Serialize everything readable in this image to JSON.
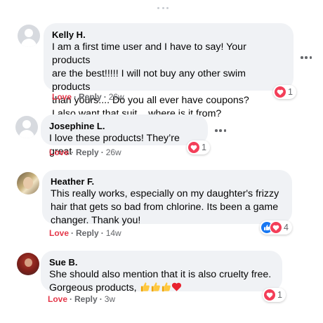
{
  "comments": [
    {
      "name": "Kelly H.",
      "text": "I am a first time user and I have to say! Your products\nare the best!!!!! I will not buy any other swim products\nthan yours.... Do you all ever have coupons?\nI also want that suit... where is it from?",
      "love_label": "Love",
      "reply_label": "Reply",
      "time": "26w",
      "reaction_count": "1",
      "reaction_icons": [
        "love-icon"
      ]
    },
    {
      "name": "Josephine L.",
      "text": "I love these products! They’re great",
      "love_label": "Love",
      "reply_label": "Reply",
      "time": "26w",
      "reaction_count": "1",
      "reaction_icons": [
        "love-icon"
      ]
    },
    {
      "name": "Heather F.",
      "text": "This really works, especially on my daughter's frizzy\nhair that gets so bad from chlorine. Its been a game\nchanger. Thank you!",
      "love_label": "Love",
      "reply_label": "Reply",
      "time": "14w",
      "reaction_count": "4",
      "reaction_icons": [
        "like-icon",
        "love-icon"
      ]
    },
    {
      "name": "Sue B.",
      "text_line1": "She should also mention that it is also cruelty free.",
      "text_line2": "Gorgeous products, ",
      "text_emojis": [
        "thumbs-up-icon",
        "thumbs-up-icon",
        "thumbs-up-icon",
        "red-heart-icon"
      ],
      "love_label": "Love",
      "reply_label": "Reply",
      "time": "3w",
      "reaction_count": "1",
      "reaction_icons": [
        "love-icon"
      ]
    }
  ],
  "separator": "·",
  "colors": {
    "love_red": "#e4384a",
    "bubble_bg": "#f0f2f5",
    "meta_gray": "#65676b",
    "like_blue": "#1877f2",
    "love_icon": "#f33e58"
  }
}
